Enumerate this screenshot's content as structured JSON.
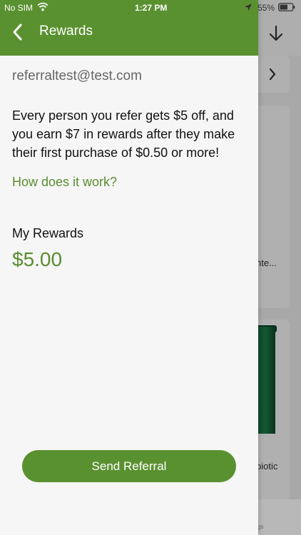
{
  "status_bar": {
    "carrier": "No SIM",
    "time": "1:27 PM",
    "battery": "55%",
    "icons": [
      "wifi-icon",
      "location-icon",
      "battery-icon"
    ]
  },
  "nav": {
    "title": "Rewards",
    "back_icon": "chevron-left-icon"
  },
  "drawer": {
    "email": "referraltest@test.com",
    "description": "Every person you refer gets $5 off, and you earn $7 in rewards after they make their first purchase of $0.50 or more!",
    "how_link": "How does it work?",
    "rewards_label": "My Rewards",
    "rewards_amount": "$5.00",
    "send_button_label": "Send Referral"
  },
  "background": {
    "item_1_text": "nte...",
    "item_2_text": "biotic",
    "bottom_text": "gs",
    "icons": [
      "download-arrow-icon",
      "chevron-right-icon"
    ]
  },
  "colors": {
    "accent": "#5a9130",
    "accent_text": "#5a8c2f",
    "drawer_bg": "#f6f6f6",
    "button_bg": "#5a9130"
  }
}
